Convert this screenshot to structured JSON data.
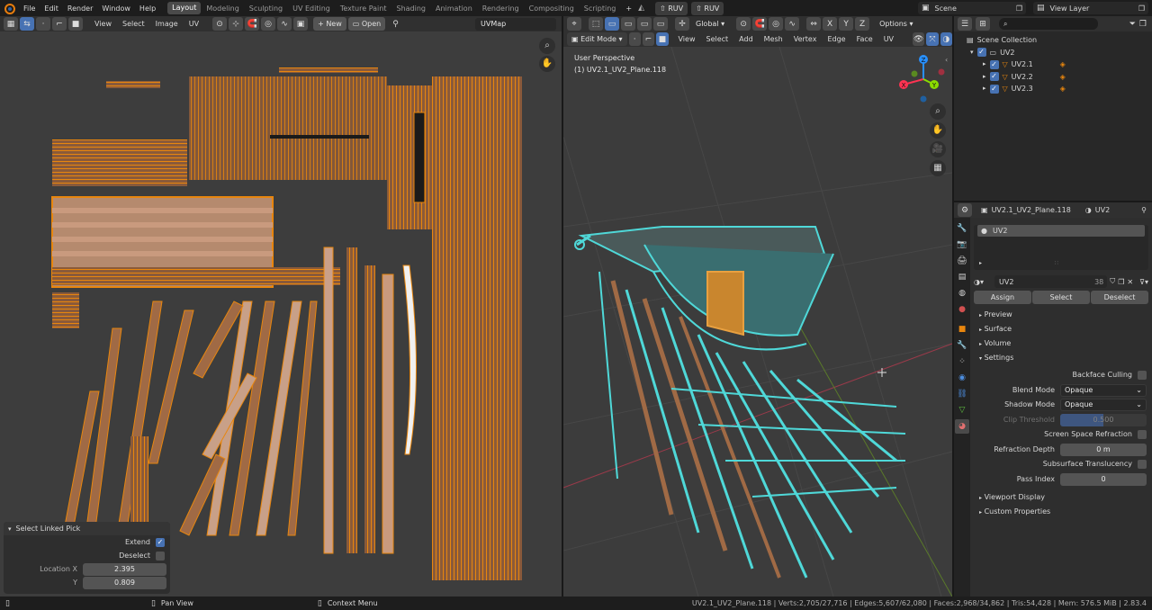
{
  "topbar": {
    "menus": [
      "File",
      "Edit",
      "Render",
      "Window",
      "Help"
    ],
    "workspaces": [
      "Layout",
      "Modeling",
      "Sculpting",
      "UV Editing",
      "Texture Paint",
      "Shading",
      "Animation",
      "Rendering",
      "Compositing",
      "Scripting"
    ],
    "active_workspace": "Layout",
    "plus": "+",
    "ruv1": "RUV",
    "ruv2": "RUV",
    "scene": "Scene",
    "view_layer": "View Layer"
  },
  "uv_editor": {
    "menus": [
      "View",
      "Select",
      "Image",
      "UV"
    ],
    "new_label": "New",
    "open_label": "Open",
    "uvmap": "UVMap"
  },
  "viewport": {
    "mode": "Edit Mode",
    "menus": [
      "View",
      "Select",
      "Add",
      "Mesh",
      "Vertex",
      "Edge",
      "Face",
      "UV"
    ],
    "orientation": "Global",
    "x": "X",
    "y": "Y",
    "z": "Z",
    "options": "Options",
    "perspective": "User Perspective",
    "object_name": "(1) UV2.1_UV2_Plane.118",
    "gizmo": {
      "x": "X",
      "y": "Y",
      "z": "Z"
    }
  },
  "operator_panel": {
    "title": "Select Linked Pick",
    "extend_label": "Extend",
    "deselect_label": "Deselect",
    "location_label": "Location X",
    "y_label": "Y",
    "x_value": "2.395",
    "y_value": "0.809"
  },
  "outliner": {
    "root": "Scene Collection",
    "collection": "UV2",
    "items": [
      "UV2.1",
      "UV2.2",
      "UV2.3"
    ]
  },
  "properties": {
    "object": "UV2.1_UV2_Plane.118",
    "material_tab": "UV2",
    "slot": "UV2",
    "material_name": "UV2",
    "users": "38",
    "assign": "Assign",
    "select": "Select",
    "deselect": "Deselect",
    "panels": [
      "Preview",
      "Surface",
      "Volume"
    ],
    "settings": "Settings",
    "backface_culling": "Backface Culling",
    "blend_mode_label": "Blend Mode",
    "blend_mode_value": "Opaque",
    "shadow_mode_label": "Shadow Mode",
    "shadow_mode_value": "Opaque",
    "clip_threshold_label": "Clip Threshold",
    "clip_threshold_value": "0.500",
    "ssr_label": "Screen Space Refraction",
    "refraction_depth_label": "Refraction Depth",
    "refraction_depth_value": "0 m",
    "sss_label": "Subsurface Translucency",
    "pass_index_label": "Pass Index",
    "pass_index_value": "0",
    "viewport_display": "Viewport Display",
    "custom_properties": "Custom Properties"
  },
  "statusbar": {
    "pan_view": "Pan View",
    "context_menu": "Context Menu",
    "stats": "UV2.1_UV2_Plane.118 | Verts:2,705/27,716 | Edges:5,607/62,080 | Faces:2,968/34,862 | Tris:54,428 | Mem: 576.5 MiB | 2.83.4"
  },
  "colors": {
    "accent": "#4772b3",
    "orange": "#e88a1a",
    "cyan": "#4fd8d8",
    "wood": "#a06a45",
    "axis_x": "#ff3352",
    "axis_y": "#8bdc00",
    "axis_z": "#2890ff"
  }
}
